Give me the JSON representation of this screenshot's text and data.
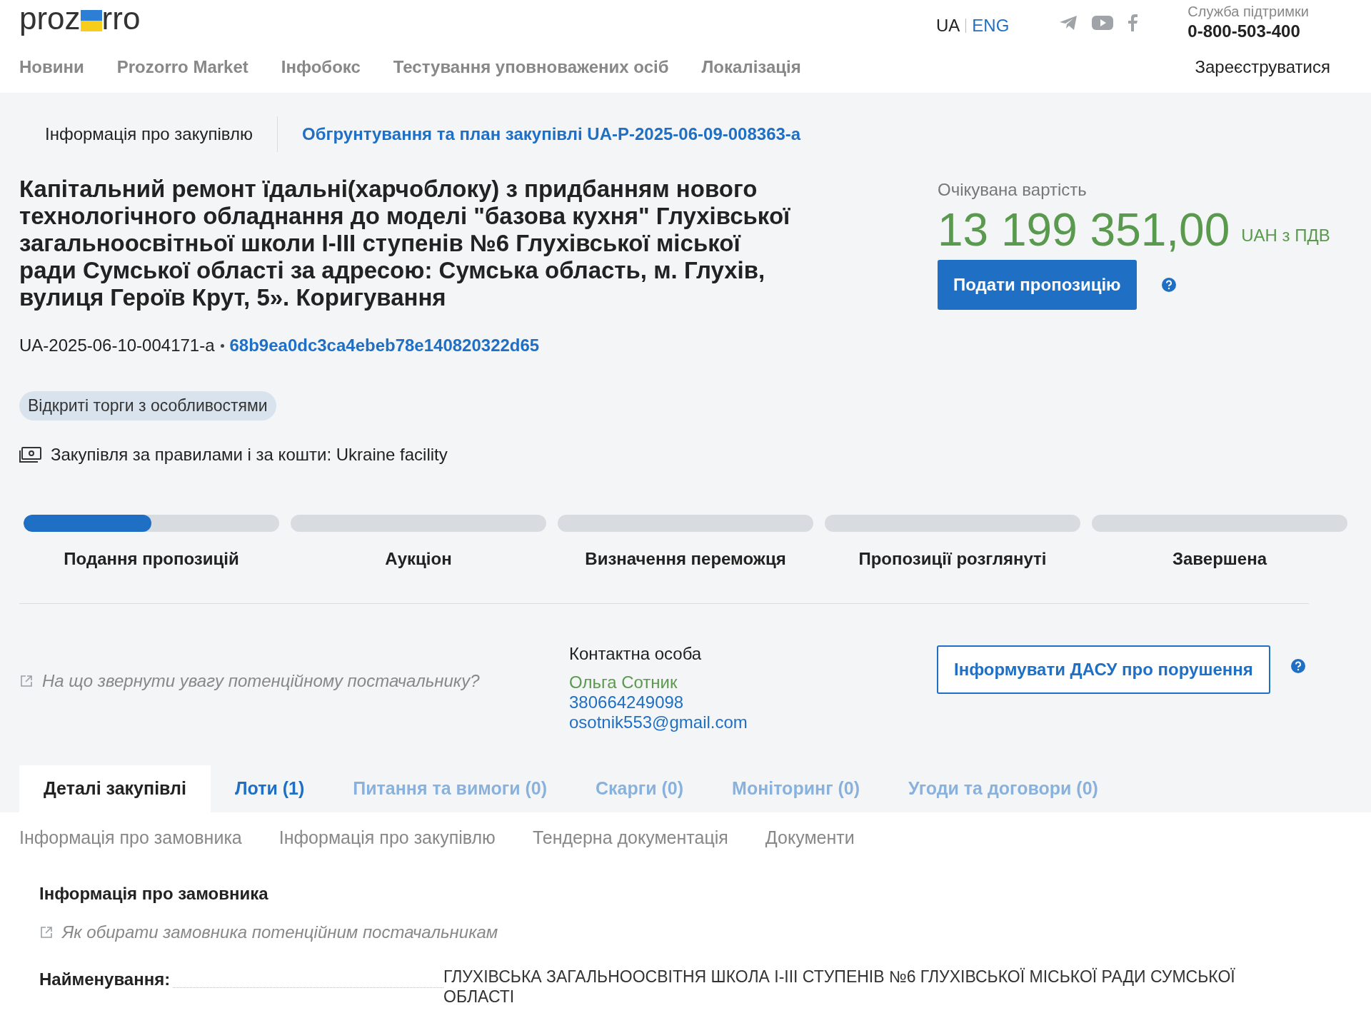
{
  "header": {
    "logo": {
      "left": "proz",
      "right": "rro"
    },
    "languages": [
      {
        "label": "UA",
        "selected": true
      },
      {
        "label": "ENG",
        "selected": false
      }
    ],
    "support": {
      "label": "Служба підтримки",
      "phone": "0-800-503-400"
    },
    "nav": [
      "Новини",
      "Prozorro Market",
      "Інфобокс",
      "Тестування уповноважених осіб",
      "Локалізація"
    ],
    "register": "Зареєструватися"
  },
  "top_tabs": [
    {
      "label": "Інформація про закупівлю",
      "selected": true
    },
    {
      "label": "Обгрунтування та план закупівлі UA-P-2025-06-09-008363-a",
      "selected": false
    }
  ],
  "tender": {
    "title": "Капітальний ремонт їдальні(харчоблоку) з придбанням нового технологічного обладнання до моделі \"базова кухня\" Глухівської загальноосвітньої школи І-ІІІ ступенів №6 Глухівської міської ради Сумської області за адресою: Сумська область, м. Глухів, вулиця Героїв Крут, 5». Коригування",
    "id": "UA-2025-06-10-004171-a",
    "hash": "68b9ea0dc3ca4ebeb78e140820322d65",
    "type_badge": "Відкриті торги з особливостями",
    "funding": "Закупівля за правилами і за кошти: Ukraine facility"
  },
  "value": {
    "label": "Очікувана вартість",
    "amount": "13 199 351,00",
    "currency": "UAH з ПДВ",
    "button": "Подати пропозицію"
  },
  "stages": [
    {
      "label": "Подання пропозицій",
      "level": 0.5
    },
    {
      "label": "Аукціон"
    },
    {
      "label": "Визначення переможця"
    },
    {
      "label": "Пропозиції розглянуті"
    },
    {
      "label": "Завершена"
    }
  ],
  "supplier_hint": "На що звернути увагу потенційному постачальнику?",
  "contact": {
    "label": "Контактна особа",
    "name": "Ольга Сотник",
    "phone": "380664249098",
    "email": "osotnik553@gmail.com"
  },
  "report_button": "Інформувати ДАСУ про порушення",
  "tabs": [
    {
      "label": "Деталі закупівлі",
      "selected": true,
      "disabled": false
    },
    {
      "label": "Лоти (1)",
      "selected": false,
      "disabled": false
    },
    {
      "label": "Питання та вимоги (0)",
      "selected": false,
      "disabled": true
    },
    {
      "label": "Скарги (0)",
      "selected": false,
      "disabled": true
    },
    {
      "label": "Моніторинг (0)",
      "selected": false,
      "disabled": true
    },
    {
      "label": "Угоди та договори (0)",
      "selected": false,
      "disabled": true
    }
  ],
  "subtabs": [
    "Інформація про замовника",
    "Інформація про закупівлю",
    "Тендерна документація",
    "Документи"
  ],
  "customer": {
    "heading": "Інформація про замовника",
    "hint": "Як обирати замовника потенційним постачальникам",
    "fields": [
      {
        "label": "Найменування:",
        "value": "ГЛУХІВСЬКА ЗАГАЛЬНООСВІТНЯ ШКОЛА І-ІІІ СТУПЕНІВ №6 ГЛУХІВСЬКОЇ МІСЬКОЇ РАДИ СУМСЬКОЇ ОБЛАСТІ"
      }
    ]
  }
}
